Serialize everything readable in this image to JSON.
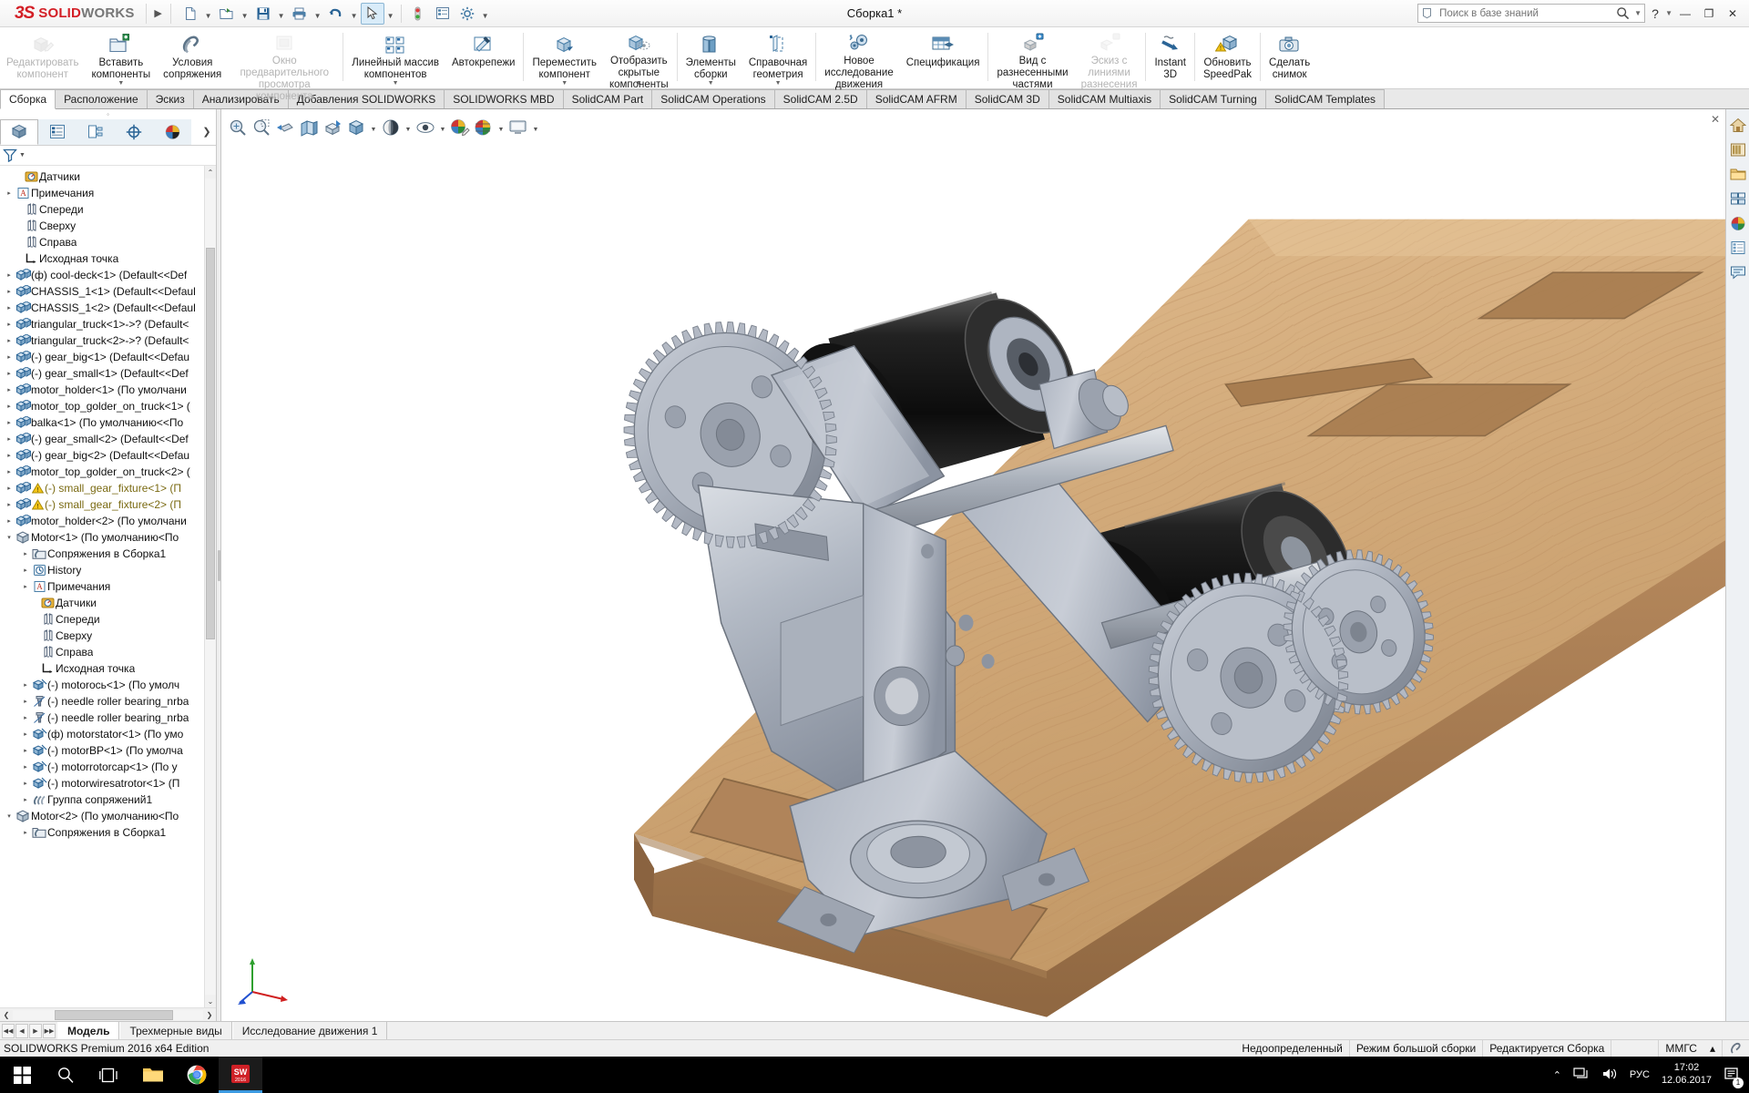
{
  "titlebar": {
    "brand_mark": "3S",
    "brand_solid": "SOLID",
    "brand_works": "WORKS",
    "document_title": "Сборка1 *",
    "search_placeholder": "Поиск в базе знаний",
    "help_label": "?",
    "minimize_label": "—",
    "restore_label": "❐",
    "close_label": "✕"
  },
  "ribbon": {
    "items": [
      {
        "label": "Редактировать\nкомпонент",
        "icon": "edit-component-icon",
        "dim": true,
        "dropdown": false
      },
      {
        "label": "Вставить\nкомпоненты",
        "icon": "insert-components-icon",
        "dim": false,
        "dropdown": true
      },
      {
        "label": "Условия\nсопряжения",
        "icon": "mate-icon",
        "dim": false,
        "dropdown": false
      },
      {
        "label": "Окно предварительного\nпросмотра компонента",
        "icon": "component-preview-icon",
        "dim": true,
        "dropdown": false
      },
      {
        "label": "Линейный массив\nкомпонентов",
        "icon": "linear-pattern-icon",
        "dim": false,
        "dropdown": true
      },
      {
        "label": "Автокрепежи",
        "icon": "smart-fasteners-icon",
        "dim": false,
        "dropdown": false
      },
      {
        "label": "Переместить\nкомпонент",
        "icon": "move-component-icon",
        "dim": false,
        "dropdown": true
      },
      {
        "label": "Отобразить\nскрытые\nкомпоненты",
        "icon": "show-hidden-icon",
        "dim": false,
        "dropdown": true
      },
      {
        "label": "Элементы\nсборки",
        "icon": "assembly-features-icon",
        "dim": false,
        "dropdown": true
      },
      {
        "label": "Справочная\nгеометрия",
        "icon": "reference-geometry-icon",
        "dim": false,
        "dropdown": true
      },
      {
        "label": "Новое\nисследование\nдвижения",
        "icon": "new-motion-study-icon",
        "dim": false,
        "dropdown": false
      },
      {
        "label": "Спецификация",
        "icon": "bom-icon",
        "dim": false,
        "dropdown": false
      },
      {
        "label": "Вид с\nразнесенными\nчастями",
        "icon": "exploded-view-icon",
        "dim": false,
        "dropdown": false
      },
      {
        "label": "Эскиз с\nлиниями\nразнесения",
        "icon": "explode-line-sketch-icon",
        "dim": true,
        "dropdown": false
      },
      {
        "label": "Instant\n3D",
        "icon": "instant3d-icon",
        "dim": false,
        "dropdown": false
      },
      {
        "label": "Обновить\nSpeedPak",
        "icon": "update-speedpak-icon",
        "dim": false,
        "dropdown": false
      },
      {
        "label": "Сделать\nснимок",
        "icon": "take-snapshot-icon",
        "dim": false,
        "dropdown": false
      }
    ],
    "separators_after": [
      3,
      5,
      7,
      9,
      11,
      13,
      14,
      15
    ]
  },
  "tabs": [
    {
      "label": "Сборка",
      "active": true
    },
    {
      "label": "Расположение",
      "active": false
    },
    {
      "label": "Эскиз",
      "active": false
    },
    {
      "label": "Анализировать",
      "active": false
    },
    {
      "label": "Добавления SOLIDWORKS",
      "active": false
    },
    {
      "label": "SOLIDWORKS MBD",
      "active": false
    },
    {
      "label": "SolidCAM Part",
      "active": false
    },
    {
      "label": "SolidCAM Operations",
      "active": false
    },
    {
      "label": "SolidCAM 2.5D",
      "active": false
    },
    {
      "label": "SolidCAM AFRM",
      "active": false
    },
    {
      "label": "SolidCAM 3D",
      "active": false
    },
    {
      "label": "SolidCAM Multiaxis",
      "active": false
    },
    {
      "label": "SolidCAM Turning",
      "active": false
    },
    {
      "label": "SolidCAM Templates",
      "active": false
    }
  ],
  "tree_panel": {
    "tabs": [
      {
        "icon": "feature-manager-tree-icon",
        "active": true
      },
      {
        "icon": "property-manager-icon",
        "active": false
      },
      {
        "icon": "configuration-manager-icon",
        "active": false
      },
      {
        "icon": "dimxpert-manager-icon",
        "active": false
      },
      {
        "icon": "display-manager-icon",
        "active": false
      }
    ],
    "more_label": "❯",
    "filter_placeholder": "",
    "rows": [
      {
        "indent": 1,
        "expand": "",
        "icon": "sensors-icon",
        "label": "Датчики"
      },
      {
        "indent": 0,
        "expand": "▸",
        "icon": "annotations-icon",
        "label": "Примечания"
      },
      {
        "indent": 1,
        "expand": "",
        "icon": "plane-icon",
        "label": "Спереди"
      },
      {
        "indent": 1,
        "expand": "",
        "icon": "plane-icon",
        "label": "Сверху"
      },
      {
        "indent": 1,
        "expand": "",
        "icon": "plane-icon",
        "label": "Справа"
      },
      {
        "indent": 1,
        "expand": "",
        "icon": "origin-icon",
        "label": "Исходная точка"
      },
      {
        "indent": 0,
        "expand": "▸",
        "icon": "component-icon",
        "label": "(ф) cool-deck<1>  (Default<<Def"
      },
      {
        "indent": 0,
        "expand": "▸",
        "icon": "component-icon",
        "label": "CHASSIS_1<1>  (Default<<Defaul"
      },
      {
        "indent": 0,
        "expand": "▸",
        "icon": "component-icon",
        "label": "CHASSIS_1<2>  (Default<<Defaul"
      },
      {
        "indent": 0,
        "expand": "▸",
        "icon": "component-icon",
        "label": "triangular_truck<1>->? (Default<"
      },
      {
        "indent": 0,
        "expand": "▸",
        "icon": "component-icon",
        "label": "triangular_truck<2>->? (Default<"
      },
      {
        "indent": 0,
        "expand": "▸",
        "icon": "component-icon",
        "label": "(-) gear_big<1>  (Default<<Defau"
      },
      {
        "indent": 0,
        "expand": "▸",
        "icon": "component-icon",
        "label": "(-) gear_small<1>  (Default<<Def"
      },
      {
        "indent": 0,
        "expand": "▸",
        "icon": "component-icon",
        "label": "motor_holder<1>  (По умолчани"
      },
      {
        "indent": 0,
        "expand": "▸",
        "icon": "component-icon",
        "label": "motor_top_golder_on_truck<1> ("
      },
      {
        "indent": 0,
        "expand": "▸",
        "icon": "component-icon",
        "label": "balka<1>  (По умолчанию<<По"
      },
      {
        "indent": 0,
        "expand": "▸",
        "icon": "component-icon",
        "label": "(-) gear_small<2>  (Default<<Def"
      },
      {
        "indent": 0,
        "expand": "▸",
        "icon": "component-icon",
        "label": "(-) gear_big<2>  (Default<<Defau"
      },
      {
        "indent": 0,
        "expand": "▸",
        "icon": "component-icon",
        "label": "motor_top_golder_on_truck<2> ("
      },
      {
        "indent": 0,
        "expand": "▸",
        "icon": "component-icon",
        "label": "(-) small_gear_fixture<1>  (П",
        "warning": true
      },
      {
        "indent": 0,
        "expand": "▸",
        "icon": "component-icon",
        "label": "(-) small_gear_fixture<2>  (П",
        "warning": true
      },
      {
        "indent": 0,
        "expand": "▸",
        "icon": "component-icon",
        "label": "motor_holder<2>  (По умолчани"
      },
      {
        "indent": 0,
        "expand": "▾",
        "icon": "subassembly-icon",
        "label": "Motor<1>  (По умолчанию<По"
      },
      {
        "indent": 2,
        "expand": "▸",
        "icon": "mates-folder-icon",
        "label": "Сопряжения в Сборка1"
      },
      {
        "indent": 2,
        "expand": "▸",
        "icon": "history-icon",
        "label": "History"
      },
      {
        "indent": 2,
        "expand": "▸",
        "icon": "annotations-icon",
        "label": "Примечания"
      },
      {
        "indent": 3,
        "expand": "",
        "icon": "sensors-icon",
        "label": "Датчики"
      },
      {
        "indent": 3,
        "expand": "",
        "icon": "plane-icon",
        "label": "Спереди"
      },
      {
        "indent": 3,
        "expand": "",
        "icon": "plane-icon",
        "label": "Сверху"
      },
      {
        "indent": 3,
        "expand": "",
        "icon": "plane-icon",
        "label": "Справа"
      },
      {
        "indent": 3,
        "expand": "",
        "icon": "origin-icon",
        "label": "Исходная точка"
      },
      {
        "indent": 2,
        "expand": "▸",
        "icon": "part-icon",
        "label": "(-) motorocь<1>  (По умолч"
      },
      {
        "indent": 2,
        "expand": "▸",
        "icon": "toolbox-part-icon",
        "label": "(-) needle roller bearing_nrba"
      },
      {
        "indent": 2,
        "expand": "▸",
        "icon": "toolbox-part-icon",
        "label": "(-) needle roller bearing_nrba"
      },
      {
        "indent": 2,
        "expand": "▸",
        "icon": "part-icon",
        "label": "(ф) motorstator<1>  (По умо"
      },
      {
        "indent": 2,
        "expand": "▸",
        "icon": "part-icon",
        "label": "(-) motorBP<1>  (По умолча"
      },
      {
        "indent": 2,
        "expand": "▸",
        "icon": "part-icon",
        "label": "(-) motorrotorcap<1>  (По у"
      },
      {
        "indent": 2,
        "expand": "▸",
        "icon": "part-icon",
        "label": "(-) motorwiresatrotor<1>  (П"
      },
      {
        "indent": 2,
        "expand": "▸",
        "icon": "mate-group-icon",
        "label": "Группа сопряжений1"
      },
      {
        "indent": 0,
        "expand": "▾",
        "icon": "subassembly-icon",
        "label": "Motor<2>  (По умолчанию<По"
      },
      {
        "indent": 2,
        "expand": "▸",
        "icon": "mates-folder-icon",
        "label": "Сопряжения в Сборка1"
      }
    ],
    "hscroll_left": "❮",
    "hscroll_right": "❯",
    "vscroll_up": "⌃",
    "vscroll_down": "⌄"
  },
  "viewport": {
    "hud_buttons": [
      {
        "icon": "zoom-to-fit-icon",
        "dropdown": false
      },
      {
        "icon": "zoom-to-area-icon",
        "dropdown": false
      },
      {
        "icon": "previous-view-icon",
        "dropdown": false
      },
      {
        "icon": "section-view-icon",
        "dropdown": false
      },
      {
        "icon": "view-orientation-icon",
        "dropdown": false
      },
      {
        "icon": "view-orientation-cube-icon",
        "dropdown": true
      },
      {
        "icon": "display-style-icon",
        "dropdown": true
      },
      {
        "icon": "hide-show-items-icon",
        "dropdown": true
      },
      {
        "icon": "edit-appearance-icon",
        "dropdown": false
      },
      {
        "icon": "apply-scene-icon",
        "dropdown": true
      },
      {
        "icon": "view-settings-icon",
        "dropdown": true
      }
    ],
    "close_label": "✕",
    "triad_axes": {
      "x": "X",
      "y": "Y",
      "z": "Z"
    }
  },
  "task_pane": {
    "buttons": [
      {
        "icon": "home-icon"
      },
      {
        "icon": "design-library-icon"
      },
      {
        "icon": "file-explorer-icon"
      },
      {
        "icon": "view-palette-icon"
      },
      {
        "icon": "appearances-scenes-icon"
      },
      {
        "icon": "custom-properties-icon"
      },
      {
        "icon": "solidworks-forum-icon"
      }
    ]
  },
  "doc_tabs": [
    {
      "label": "Модель",
      "active": true
    },
    {
      "label": "Трехмерные виды",
      "active": false
    },
    {
      "label": "Исследование движения 1",
      "active": false
    }
  ],
  "statusbar": {
    "edition": "SOLIDWORKS Premium 2016 x64 Edition",
    "cells": [
      "Недоопределенный",
      "Режим большой сборки",
      "Редактируется Сборка"
    ],
    "units": "ММГС",
    "units_caret": "▴",
    "overlay_icon": "mate-icon"
  },
  "taskbar": {
    "items": [
      {
        "icon": "windows-start-icon",
        "active": false
      },
      {
        "icon": "search-icon",
        "active": false
      },
      {
        "icon": "task-view-icon",
        "active": false
      },
      {
        "icon": "file-explorer-icon",
        "active": false
      },
      {
        "icon": "chrome-icon",
        "active": false
      },
      {
        "icon": "solidworks-2016-icon",
        "active": true,
        "badge": "SW"
      }
    ],
    "tray": {
      "chevron": "⌃",
      "network_icon": "network-icon",
      "volume_icon": "volume-icon",
      "language": "РУС",
      "time": "17:02",
      "date": "12.06.2017",
      "notification_count": "1"
    }
  },
  "colors": {
    "brand_red": "#d31f26",
    "accent_blue": "#2a6496",
    "warning_yellow": "#f5c518",
    "taskbar_black": "#000000",
    "wood_light": "#d6b083",
    "wood_dark": "#b0865a",
    "metal_gray": "#9aa2ae",
    "motor_black": "#1b1b1b"
  }
}
